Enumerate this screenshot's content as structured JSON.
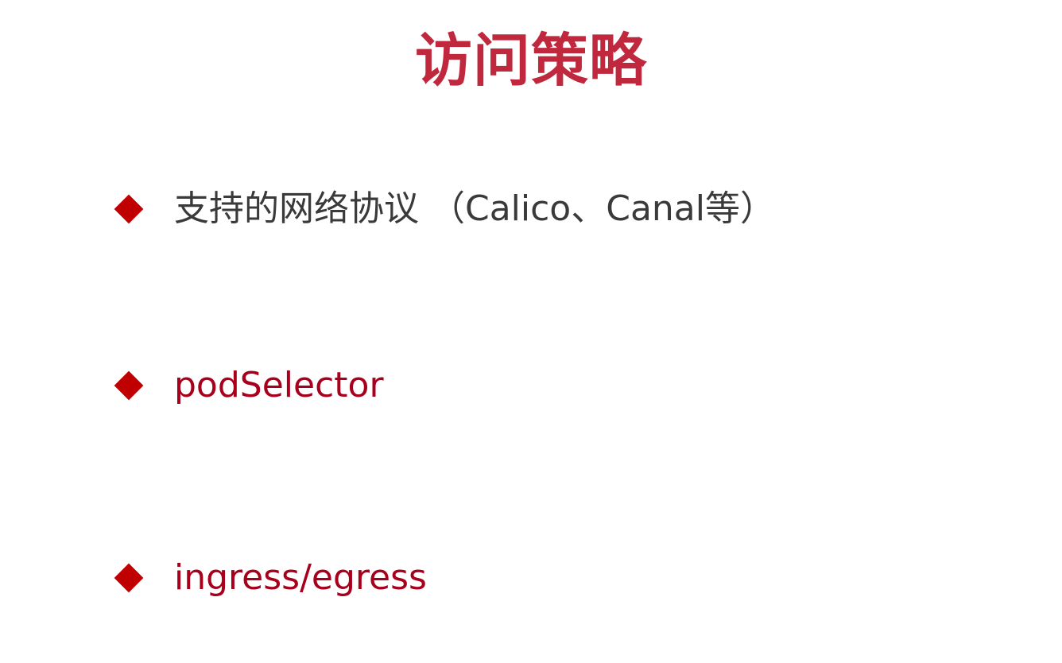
{
  "slide": {
    "title": "访问策略",
    "bullets": [
      {
        "text": "支持的网络协议 （Calico、Canal等）"
      },
      {
        "text": "podSelector"
      },
      {
        "text": "ingress/egress"
      }
    ]
  },
  "colors": {
    "title": "#c0283e",
    "bullet_marker": "#c00000",
    "highlight_text": "#a8001c",
    "body_text": "#3a3a3a"
  }
}
